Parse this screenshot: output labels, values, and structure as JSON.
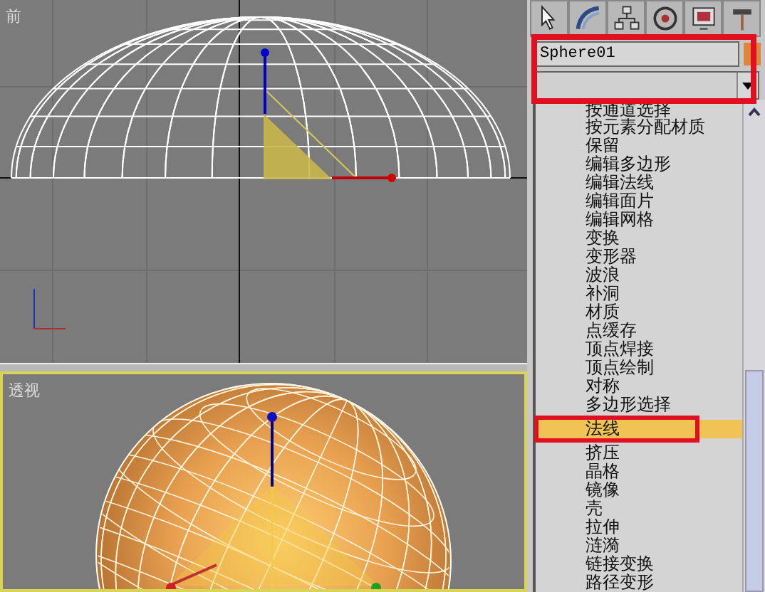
{
  "viewports": [
    {
      "label": "前",
      "kind": "front",
      "active": false
    },
    {
      "label": "透视",
      "kind": "perspective",
      "active": true
    }
  ],
  "command_panel": {
    "object_name": "Sphere01",
    "modifiers": [
      {
        "label": "按通道选择",
        "selected": false
      },
      {
        "label": "按元素分配材质",
        "selected": false
      },
      {
        "label": "保留",
        "selected": false
      },
      {
        "label": "编辑多边形",
        "selected": false
      },
      {
        "label": "编辑法线",
        "selected": false
      },
      {
        "label": "编辑面片",
        "selected": false
      },
      {
        "label": "编辑网格",
        "selected": false
      },
      {
        "label": "变换",
        "selected": false
      },
      {
        "label": "变形器",
        "selected": false
      },
      {
        "label": "波浪",
        "selected": false
      },
      {
        "label": "补洞",
        "selected": false
      },
      {
        "label": "材质",
        "selected": false
      },
      {
        "label": "点缓存",
        "selected": false
      },
      {
        "label": "顶点焊接",
        "selected": false
      },
      {
        "label": "顶点绘制",
        "selected": false
      },
      {
        "label": "对称",
        "selected": false
      },
      {
        "label": "多边形选择",
        "selected": false
      },
      {
        "label": "法线",
        "selected": true
      },
      {
        "label": "挤压",
        "selected": false
      },
      {
        "label": "晶格",
        "selected": false
      },
      {
        "label": "镜像",
        "selected": false
      },
      {
        "label": "壳",
        "selected": false
      },
      {
        "label": "拉伸",
        "selected": false
      },
      {
        "label": "涟漪",
        "selected": false
      },
      {
        "label": "链接变换",
        "selected": false
      },
      {
        "label": "路径变形",
        "selected": false
      }
    ]
  }
}
